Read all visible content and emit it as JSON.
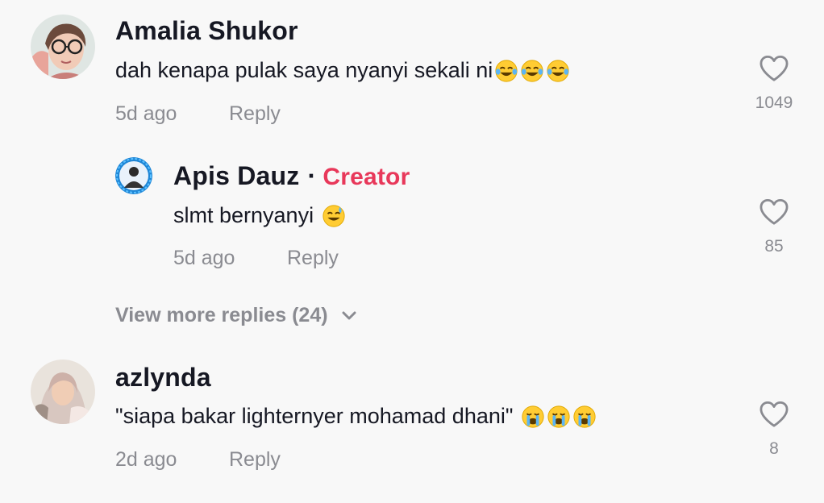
{
  "comments": [
    {
      "username": "Amalia Shukor",
      "text": "dah kenapa pulak saya nyanyi sekali ni",
      "emoji": [
        "tears-of-joy",
        "tears-of-joy",
        "tears-of-joy"
      ],
      "time": "5d ago",
      "reply_label": "Reply",
      "likes": "1049"
    },
    {
      "username": "azlynda",
      "text": "\"siapa bakar lighternyer mohamad dhani\"",
      "emoji": [
        "crying",
        "crying",
        "crying"
      ],
      "time": "2d ago",
      "reply_label": "Reply",
      "likes": "8"
    }
  ],
  "reply": {
    "username": "Apis Dauz",
    "separator": "·",
    "badge": "Creator",
    "text": "slmt bernyanyi",
    "emoji": [
      "grinning-sweat"
    ],
    "time": "5d ago",
    "reply_label": "Reply",
    "likes": "85"
  },
  "view_more": {
    "label": "View more replies (24)",
    "icon": "chevron-down-icon"
  },
  "colors": {
    "creator_accent": "#e8385a",
    "secondary_text": "#8a8b91",
    "primary_text": "#161823",
    "background": "#f8f8f8"
  }
}
